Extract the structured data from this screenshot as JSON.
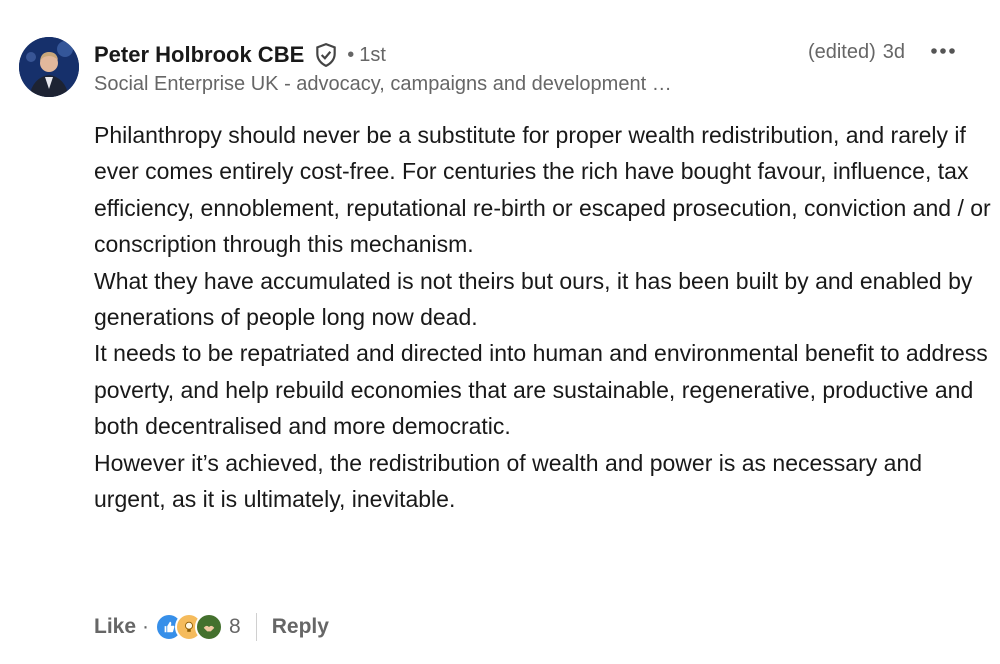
{
  "comment": {
    "author": {
      "name": "Peter Holbrook CBE",
      "degree": "1st",
      "headline": "Social Enterprise UK - advocacy, campaigns and development …",
      "verified_icon": "shield-check-icon",
      "avatar_icon": "profile-photo"
    },
    "meta": {
      "edited": "(edited)",
      "timestamp": "3d",
      "more_icon": "more-horizontal-icon"
    },
    "paragraphs": [
      "Philanthropy should never be a substitute for proper wealth redistribution, and rarely if ever comes entirely cost-free. For centuries the rich have bought favour, influence, tax efficiency, ennoblement, reputational re-birth or escaped prosecution, conviction and / or conscription through this mechanism.",
      "What they have accumulated is not theirs but ours, it has been built by and enabled by generations of people long now dead.",
      "It needs to be repatriated and directed into human and environmental benefit to address poverty, and help rebuild economies that are sustainable, regenerative, productive and both decentralised and more democratic.",
      "However it’s achieved, the redistribution of wealth and power is as necessary and urgent, as it is ultimately, inevitable."
    ],
    "actions": {
      "like_label": "Like",
      "separator": "·",
      "reactions": [
        {
          "icon": "like-reaction-icon",
          "color": "#378fe9"
        },
        {
          "icon": "insightful-reaction-icon",
          "color": "#f5bb5c"
        },
        {
          "icon": "support-reaction-icon",
          "color": "#44712e"
        }
      ],
      "reaction_count": "8",
      "reply_label": "Reply"
    }
  }
}
